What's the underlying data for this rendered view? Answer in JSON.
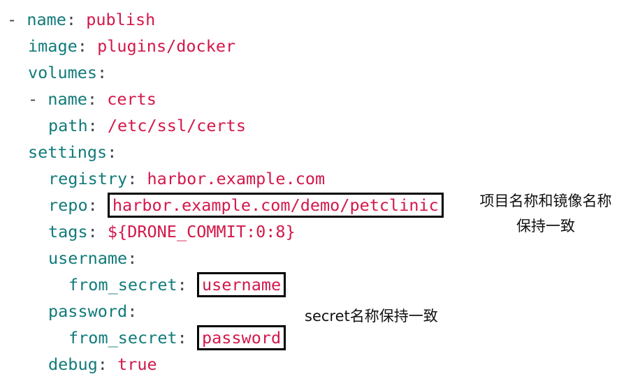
{
  "colors": {
    "key": "#127a7a",
    "value": "#d3184a",
    "punctuation": "#3d4450",
    "highlight_border": "#000000"
  },
  "yaml": {
    "l1": {
      "dash": "-",
      "key": "name",
      "colon": ":",
      "value": "publish"
    },
    "l2": {
      "key": "image",
      "colon": ":",
      "value": "plugins/docker"
    },
    "l3": {
      "key": "volumes",
      "colon": ":"
    },
    "l4": {
      "dash": "-",
      "key": "name",
      "colon": ":",
      "value": "certs"
    },
    "l5": {
      "key": "path",
      "colon": ":",
      "value": "/etc/ssl/certs"
    },
    "l6": {
      "key": "settings",
      "colon": ":"
    },
    "l7": {
      "key": "registry",
      "colon": ":",
      "value": "harbor.example.com"
    },
    "l8": {
      "key": "repo",
      "colon": ":",
      "value": "harbor.example.com/demo/petclinic"
    },
    "l9": {
      "key": "tags",
      "colon": ":",
      "value": "${DRONE_COMMIT:0:8}"
    },
    "l10": {
      "key": "username",
      "colon": ":"
    },
    "l11": {
      "key": "from_secret",
      "colon": ":",
      "value": "username"
    },
    "l12": {
      "key": "password",
      "colon": ":"
    },
    "l13": {
      "key": "from_secret",
      "colon": ":",
      "value": "password"
    },
    "l14": {
      "key": "debug",
      "colon": ":",
      "value": "true"
    }
  },
  "notes": {
    "repo_line1": "项目名称和镜像名称",
    "repo_line2": "保持一致",
    "secret": "secret名称保持一致"
  }
}
